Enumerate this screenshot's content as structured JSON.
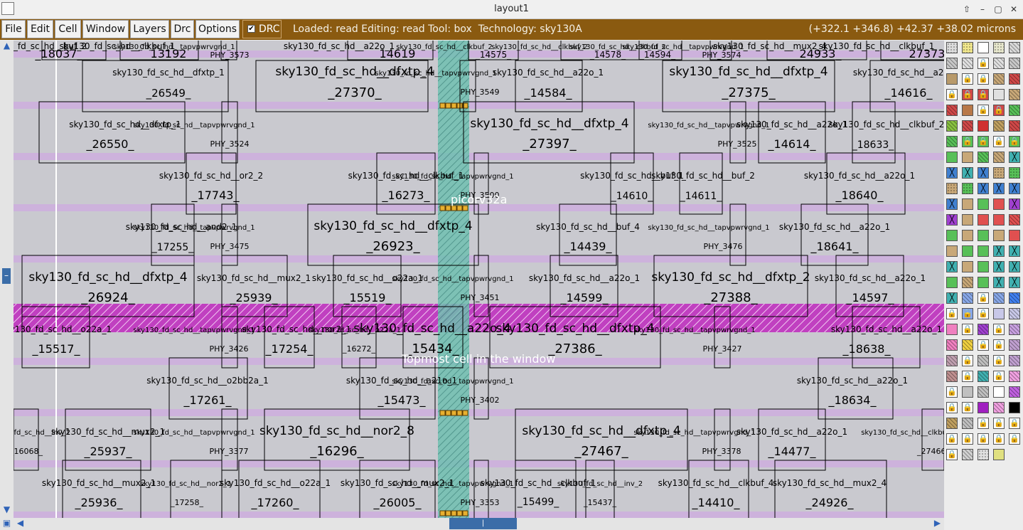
{
  "window": {
    "title": "layout1",
    "controls": [
      "⇧",
      "–",
      "▢",
      "✕"
    ]
  },
  "menu": {
    "items": [
      "File",
      "Edit",
      "Cell",
      "Window",
      "Layers",
      "Drc",
      "Options"
    ]
  },
  "drc": {
    "label": "DRC",
    "checked": true,
    "check_glyph": "✔"
  },
  "status": {
    "text": "Loaded: read Editing: read Tool: box  Technology: sky130A",
    "coords": "(+322.1 +346.8) +42.37 +38.02 microns"
  },
  "overlays": {
    "pin_label": "picorv32a",
    "cell_message": "Topmost cell in the window"
  },
  "colors": {
    "brown_bar": "#8a5a10",
    "canvas_bg": "#c9c9cf",
    "rail_purple": "#cdb2dc",
    "selected_rail": "#c040c0",
    "teal_column": "#5fb3a8",
    "cell_outline": "#000000",
    "scroll_blue": "#3b6da8"
  },
  "icons": {
    "scroll_up": "arrow-up-icon",
    "scroll_down": "arrow-down-icon",
    "scroll_left": "arrow-left-icon",
    "scroll_right": "arrow-right-icon",
    "lock": "lock-icon"
  },
  "cells": [
    {
      "type": "sky130_fd_sc_hd__buf_2",
      "name": "_18037_"
    },
    {
      "type": "sky130_fd_sc_hd__clkbuf_1",
      "name": "_13192_"
    },
    {
      "type": "sky130_fd_sc_hd__tapvpwrvgnd_1",
      "name": "PHY_3573"
    },
    {
      "type": "sky130_fd_sc_hd__a22o_1",
      "name": "_14619_"
    },
    {
      "type": "sky130_fd_sc_hd__clkbuf_2",
      "name": "_14575_"
    },
    {
      "type": "sky130_fd_sc_hd__clkbuf_2",
      "name": "_14578_"
    },
    {
      "type": "sky130_fd_sc_hd__clkbuf_2",
      "name": "_14594_"
    },
    {
      "type": "sky130_fd_sc_hd__tapvpwrvgnd_1",
      "name": "PHY_3574"
    },
    {
      "type": "sky130_fd_sc_hd__mux2_4",
      "name": "_24933_"
    },
    {
      "type": "sky130_fd_sc_hd__clkbuf_1",
      "name": "_27373_"
    },
    {
      "type": "sky130_fd_sc_hd__dfxtp_1",
      "name": "_26549_"
    },
    {
      "type": "sky130_fd_sc_hd__dfxtp_4",
      "name": "_27370_"
    },
    {
      "type": "sky130_fd_sc_hd__tapvpwrvgnd_1",
      "name": "PHY_3549"
    },
    {
      "type": "sky130_fd_sc_hd__a22o_1",
      "name": "_14584_"
    },
    {
      "type": "sky130_fd_sc_hd__dfxtp_4",
      "name": "_27375_"
    },
    {
      "type": "sky130_fd_sc_hd__a22o_1",
      "name": "_14616_"
    },
    {
      "type": "sky130_fd_sc_hd__dfxtp_1",
      "name": "_26550_"
    },
    {
      "type": "sky130_fd_sc_hd__tapvpwrvgnd_1",
      "name": "PHY_3524"
    },
    {
      "type": "sky130_fd_sc_hd__dfxtp_4",
      "name": "_27397_"
    },
    {
      "type": "sky130_fd_sc_hd__tapvpwrvgnd_1",
      "name": "PHY_3525"
    },
    {
      "type": "sky130_fd_sc_hd__a22o_1",
      "name": "_14614_"
    },
    {
      "type": "sky130_fd_sc_hd__clkbuf_2",
      "name": "_18633_"
    },
    {
      "type": "sky130_fd_sc_hd__or2_2",
      "name": "_17743_"
    },
    {
      "type": "sky130_fd_sc_hd__clkbuf_1",
      "name": "_16273_"
    },
    {
      "type": "sky130_fd_sc_hd__tapvpwrvgnd_1",
      "name": "PHY_3500"
    },
    {
      "type": "sky130_fd_sc_hd__buf_1",
      "name": "_14610_"
    },
    {
      "type": "sky130_fd_sc_hd__buf_2",
      "name": "_14611_"
    },
    {
      "type": "sky130_fd_sc_hd__a22o_1",
      "name": "_18640_"
    },
    {
      "type": "sky130_fd_sc_hd__and2_1",
      "name": "_17255_"
    },
    {
      "type": "sky130_fd_sc_hd__tapvpwrvgnd_1",
      "name": "PHY_3475"
    },
    {
      "type": "sky130_fd_sc_hd__dfxtp_4",
      "name": "_26923_"
    },
    {
      "type": "sky130_fd_sc_hd__buf_4",
      "name": "_14439_"
    },
    {
      "type": "sky130_fd_sc_hd__tapvpwrvgnd_1",
      "name": "PHY_3476"
    },
    {
      "type": "sky130_fd_sc_hd__a22o_1",
      "name": "_18641_"
    },
    {
      "type": "sky130_fd_sc_hd__dfxtp_4",
      "name": "_26924_"
    },
    {
      "type": "sky130_fd_sc_hd__mux2_1",
      "name": "_25939_"
    },
    {
      "type": "sky130_fd_sc_hd__o22a_1",
      "name": "_15519_"
    },
    {
      "type": "sky130_fd_sc_hd__tapvpwrvgnd_1",
      "name": "PHY_3451"
    },
    {
      "type": "sky130_fd_sc_hd__a22o_1",
      "name": "_14599_"
    },
    {
      "type": "sky130_fd_sc_hd__dfxtp_2",
      "name": "_27388_"
    },
    {
      "type": "sky130_fd_sc_hd__a22o_1",
      "name": "_14597_"
    },
    {
      "type": "sky130_fd_sc_hd__o22a_1",
      "name": "_15517_"
    },
    {
      "type": "sky130_fd_sc_hd__tapvpwrvgnd_1",
      "name": "PHY_3426"
    },
    {
      "type": "sky130_fd_sc_hd__nor2_1",
      "name": "_17254_"
    },
    {
      "type": "sky130_fd_sc_hd__o22a_1",
      "name": "_16272_"
    },
    {
      "type": "sky130_fd_sc_hd__a22o_4",
      "name": "_15434_"
    },
    {
      "type": "sky130_fd_sc_hd__dfxtp_4",
      "name": "_27386_"
    },
    {
      "type": "sky130_fd_sc_hd__tapvpwrvgnd_1",
      "name": "PHY_3427"
    },
    {
      "type": "sky130_fd_sc_hd__a22o_1",
      "name": "_18638_"
    },
    {
      "type": "sky130_fd_sc_hd__o2bb2a_1",
      "name": "_17261_"
    },
    {
      "type": "sky130_fd_sc_hd__a21o_1",
      "name": "_15473_"
    },
    {
      "type": "sky130_fd_sc_hd__tapvpwrvgnd_1",
      "name": "PHY_3402"
    },
    {
      "type": "sky130_fd_sc_hd__a22o_1",
      "name": "_18634_"
    },
    {
      "type": "sky130_fd_sc_hd__inv_2",
      "name": "_16068_"
    },
    {
      "type": "sky130_fd_sc_hd__mux2_1",
      "name": "_25937_"
    },
    {
      "type": "sky130_fd_sc_hd__tapvpwrvgnd_1",
      "name": "PHY_3377"
    },
    {
      "type": "sky130_fd_sc_hd__nor2_8",
      "name": "_16296_"
    },
    {
      "type": "sky130_fd_sc_hd__dfxtp_4",
      "name": "_27467_"
    },
    {
      "type": "sky130_fd_sc_hd__tapvpwrvgnd_1",
      "name": "PHY_3378"
    },
    {
      "type": "sky130_fd_sc_hd__a22o_1",
      "name": "_14477_"
    },
    {
      "type": "sky130_fd_sc_hd__clkbuf_1",
      "name": "_27466_"
    },
    {
      "type": "sky130_fd_sc_hd__mux2_1",
      "name": "_25936_"
    },
    {
      "type": "sky130_fd_sc_hd__nor2_1",
      "name": "_17258_"
    },
    {
      "type": "sky130_fd_sc_hd__o22a_1",
      "name": "_17260_"
    },
    {
      "type": "sky130_fd_sc_hd__mux2_1",
      "name": "_26005_"
    },
    {
      "type": "sky130_fd_sc_hd__tapvpwrvgnd_1",
      "name": "PHY_3353"
    },
    {
      "type": "sky130_fd_sc_hd__clkbuf_1",
      "name": "_15499_"
    },
    {
      "type": "sky130_fd_sc_hd__inv_2",
      "name": "_15437_"
    },
    {
      "type": "sky130_fd_sc_hd__clkbuf_4",
      "name": "_14410_"
    },
    {
      "type": "sky130_fd_sc_hd__mux2_4",
      "name": "_24926_"
    }
  ],
  "palette": {
    "swatches": [
      {
        "color": "#dcdcdc",
        "pattern": "dots"
      },
      {
        "color": "#f0e68c",
        "pattern": "dots"
      },
      {
        "color": "#ffffff",
        "pattern": "outline"
      },
      {
        "color": "#e6e6cc",
        "pattern": "dots"
      },
      {
        "color": "#d8d8d8",
        "pattern": "hatch"
      },
      {
        "color": "#c8c8c8",
        "pattern": "hatch"
      },
      {
        "color": "#e0e0e0",
        "pattern": "hatch"
      },
      {
        "color": "#ffffff",
        "pattern": "lock"
      },
      {
        "color": "#e0e0e0",
        "pattern": "hatch"
      },
      {
        "color": "#c8c8c8",
        "pattern": "hatch"
      },
      {
        "color": "#b89a6a",
        "pattern": "solid"
      },
      {
        "color": "#ffffff",
        "pattern": "lock"
      },
      {
        "color": "#ffffff",
        "pattern": "lock"
      },
      {
        "color": "#c8a878",
        "pattern": "hatch"
      },
      {
        "color": "#d04848",
        "pattern": "hatch"
      },
      {
        "color": "#ffffff",
        "pattern": "lock"
      },
      {
        "color": "#d04848",
        "pattern": "lock"
      },
      {
        "color": "#d04848",
        "pattern": "lock"
      },
      {
        "color": "#e0e0e0",
        "pattern": "solid"
      },
      {
        "color": "#c8a878",
        "pattern": "hatch"
      },
      {
        "color": "#d04848",
        "pattern": "hatch"
      },
      {
        "color": "#b87848",
        "pattern": "solid"
      },
      {
        "color": "#ffffff",
        "pattern": "lock"
      },
      {
        "color": "#d04848",
        "pattern": "lock"
      },
      {
        "color": "#58c058",
        "pattern": "hatch"
      },
      {
        "color": "#88c040",
        "pattern": "hatch"
      },
      {
        "color": "#d04848",
        "pattern": "hatch"
      },
      {
        "color": "#d03030",
        "pattern": "solid"
      },
      {
        "color": "#c0a060",
        "pattern": "hatch"
      },
      {
        "color": "#d04848",
        "pattern": "hatch"
      },
      {
        "color": "#58c058",
        "pattern": "hatch"
      },
      {
        "color": "#58c058",
        "pattern": "lock"
      },
      {
        "color": "#58c058",
        "pattern": "lock"
      },
      {
        "color": "#ffffff",
        "pattern": "lock"
      },
      {
        "color": "#58c058",
        "pattern": "lock"
      },
      {
        "color": "#58c058",
        "pattern": "solid"
      },
      {
        "color": "#c8a878",
        "pattern": "solid"
      },
      {
        "color": "#58c058",
        "pattern": "hatch"
      },
      {
        "color": "#c8a878",
        "pattern": "hatch"
      },
      {
        "color": "#40b0b0",
        "pattern": "cross"
      },
      {
        "color": "#4080d0",
        "pattern": "cross"
      },
      {
        "color": "#40b0b0",
        "pattern": "cross"
      },
      {
        "color": "#4080d0",
        "pattern": "cross"
      },
      {
        "color": "#c8a878",
        "pattern": "dots"
      },
      {
        "color": "#58c058",
        "pattern": "dots"
      },
      {
        "color": "#c8a878",
        "pattern": "dots"
      },
      {
        "color": "#58c058",
        "pattern": "dots"
      },
      {
        "color": "#4080d0",
        "pattern": "cross"
      },
      {
        "color": "#4080d0",
        "pattern": "cross"
      },
      {
        "color": "#4080d0",
        "pattern": "cross"
      },
      {
        "color": "#4080d0",
        "pattern": "cross"
      },
      {
        "color": "#c8a878",
        "pattern": "solid"
      },
      {
        "color": "#58c058",
        "pattern": "solid"
      },
      {
        "color": "#e05050",
        "pattern": "solid"
      },
      {
        "color": "#a040d0",
        "pattern": "cross"
      },
      {
        "color": "#a040d0",
        "pattern": "cross"
      },
      {
        "color": "#c8a878",
        "pattern": "solid"
      },
      {
        "color": "#e05050",
        "pattern": "solid"
      },
      {
        "color": "#e05050",
        "pattern": "solid"
      },
      {
        "color": "#e05050",
        "pattern": "hatch"
      },
      {
        "color": "#58c058",
        "pattern": "solid"
      },
      {
        "color": "#c8a878",
        "pattern": "solid"
      },
      {
        "color": "#58c058",
        "pattern": "solid"
      },
      {
        "color": "#c8a878",
        "pattern": "solid"
      },
      {
        "color": "#e05050",
        "pattern": "solid"
      },
      {
        "color": "#c8a878",
        "pattern": "solid"
      },
      {
        "color": "#58c058",
        "pattern": "solid"
      },
      {
        "color": "#58c058",
        "pattern": "solid"
      },
      {
        "color": "#40b0b0",
        "pattern": "cross"
      },
      {
        "color": "#40b0b0",
        "pattern": "cross"
      },
      {
        "color": "#40b0b0",
        "pattern": "cross"
      },
      {
        "color": "#c8a878",
        "pattern": "solid"
      },
      {
        "color": "#58c058",
        "pattern": "solid"
      },
      {
        "color": "#40b0b0",
        "pattern": "cross"
      },
      {
        "color": "#40b0b0",
        "pattern": "cross"
      },
      {
        "color": "#58c058",
        "pattern": "solid"
      },
      {
        "color": "#c8a878",
        "pattern": "hatch"
      },
      {
        "color": "#58c058",
        "pattern": "solid"
      },
      {
        "color": "#40b0b0",
        "pattern": "cross"
      },
      {
        "color": "#40b0b0",
        "pattern": "cross"
      },
      {
        "color": "#40b0b0",
        "pattern": "cross"
      },
      {
        "color": "#88a8e8",
        "pattern": "hatch"
      },
      {
        "color": "#ffffff",
        "pattern": "lock"
      },
      {
        "color": "#88a8e8",
        "pattern": "hatch"
      },
      {
        "color": "#4080f0",
        "pattern": "hatch"
      },
      {
        "color": "#ffffff",
        "pattern": "lock"
      },
      {
        "color": "#88a8e8",
        "pattern": "lock"
      },
      {
        "color": "#ffffff",
        "pattern": "lock"
      },
      {
        "color": "#c8c8e8",
        "pattern": "solid"
      },
      {
        "color": "#c8c8e8",
        "pattern": "hatch"
      },
      {
        "color": "#f080c0",
        "pattern": "solid"
      },
      {
        "color": "#ffffff",
        "pattern": "lock"
      },
      {
        "color": "#a040d0",
        "pattern": "hatch"
      },
      {
        "color": "#ffffff",
        "pattern": "lock"
      },
      {
        "color": "#c8a0e0",
        "pattern": "hatch"
      },
      {
        "color": "#f080c0",
        "pattern": "hatch"
      },
      {
        "color": "#f0d040",
        "pattern": "hatch"
      },
      {
        "color": "#ffffff",
        "pattern": "lock"
      },
      {
        "color": "#ffffff",
        "pattern": "lock"
      },
      {
        "color": "#c0a0d0",
        "pattern": "hatch"
      },
      {
        "color": "#c0a0b0",
        "pattern": "hatch"
      },
      {
        "color": "#ffffff",
        "pattern": "lock"
      },
      {
        "color": "#c0c0c0",
        "pattern": "hatch"
      },
      {
        "color": "#ffffff",
        "pattern": "lock"
      },
      {
        "color": "#c0a0d0",
        "pattern": "hatch"
      },
      {
        "color": "#c09090",
        "pattern": "hatch"
      },
      {
        "color": "#ffffff",
        "pattern": "lock"
      },
      {
        "color": "#40b0b0",
        "pattern": "hatch"
      },
      {
        "color": "#ffffff",
        "pattern": "lock"
      },
      {
        "color": "#f0a0e0",
        "pattern": "hatch"
      },
      {
        "color": "#ffffff",
        "pattern": "lock"
      },
      {
        "color": "#c0c0c0",
        "pattern": "solid"
      },
      {
        "color": "#c0c0c0",
        "pattern": "hatch"
      },
      {
        "color": "#ffffff",
        "pattern": "solid"
      },
      {
        "color": "#c060e0",
        "pattern": "hatch"
      },
      {
        "color": "#ffffff",
        "pattern": "lock"
      },
      {
        "color": "#ffffff",
        "pattern": "lock"
      },
      {
        "color": "#a020c0",
        "pattern": "solid"
      },
      {
        "color": "#f0a0e0",
        "pattern": "hatch"
      },
      {
        "color": "#000000",
        "pattern": "solid"
      },
      {
        "color": "#c0a060",
        "pattern": "hatch"
      },
      {
        "color": "#c0c0c0",
        "pattern": "hatch"
      },
      {
        "color": "#ffffff",
        "pattern": "lock"
      },
      {
        "color": "#ffffff",
        "pattern": "lock"
      },
      {
        "color": "#ffffff",
        "pattern": "lock"
      },
      {
        "color": "#ffffff",
        "pattern": "lock"
      },
      {
        "color": "#ffffff",
        "pattern": "lock"
      },
      {
        "color": "#ffffff",
        "pattern": "lock"
      },
      {
        "color": "#ffffff",
        "pattern": "lock"
      },
      {
        "color": "#ffffff",
        "pattern": "lock"
      },
      {
        "color": "#ffffff",
        "pattern": "lock"
      },
      {
        "color": "#d0d0d0",
        "pattern": "hatch"
      },
      {
        "color": "#e0e0e0",
        "pattern": "dots"
      },
      {
        "color": "#e0e080",
        "pattern": "solid"
      }
    ]
  }
}
